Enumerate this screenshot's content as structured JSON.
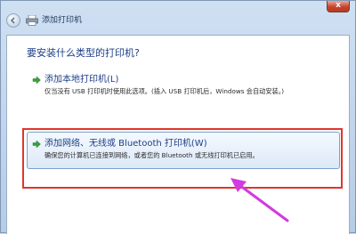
{
  "window": {
    "title": "添加打印机",
    "close_label": "x"
  },
  "main": {
    "question": "要安装什么类型的打印机?",
    "options": [
      {
        "title": "添加本地打印机(L)",
        "description": "仅当没有 USB 打印机时使用此选项。(插入 USB 打印机后，Windows 会自动安装。)"
      },
      {
        "title": "添加网络、无线或 Bluetooth 打印机(W)",
        "description": "确保您的计算机已连接到网络，或者您的 Bluetooth 或无线打印机已启用。"
      }
    ]
  },
  "colors": {
    "annotation": "#e0362c",
    "pointer": "#d33adf",
    "link_text": "#1d3e86"
  }
}
